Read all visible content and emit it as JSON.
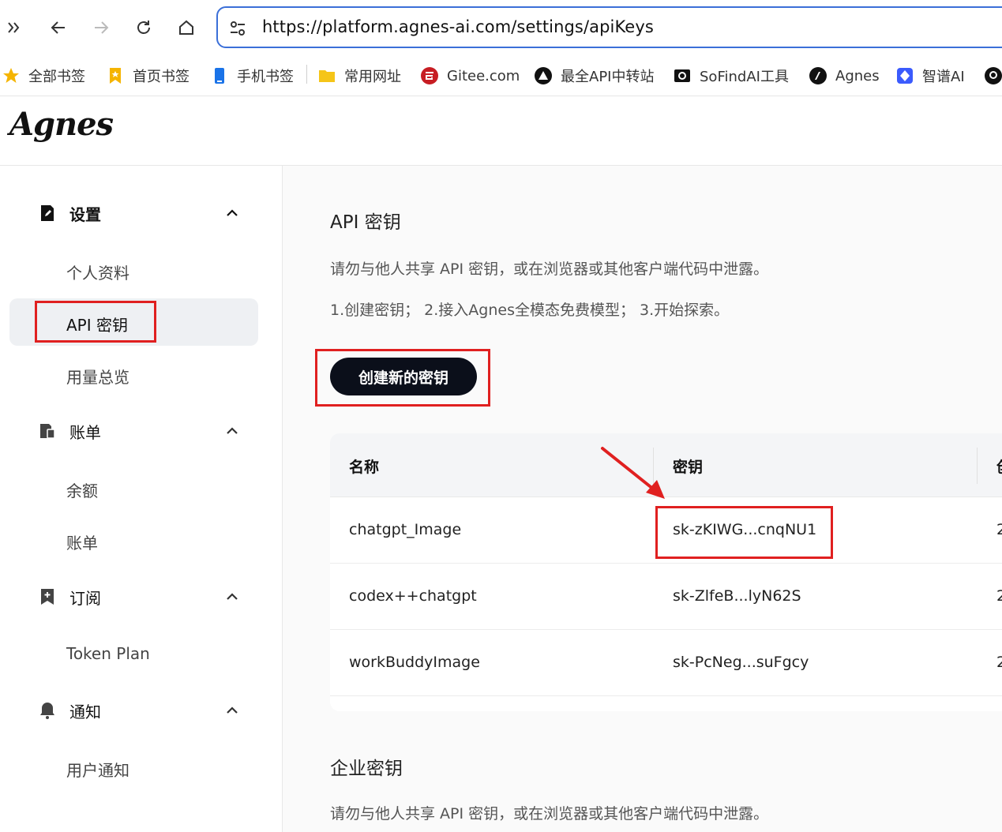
{
  "browser": {
    "url": "https://platform.agnes-ai.com/settings/apiKeys",
    "bookmarks": [
      {
        "label": "全部书签",
        "icon": "star-icon"
      },
      {
        "label": "首页书签",
        "icon": "bookmark-icon"
      },
      {
        "label": "手机书签",
        "icon": "phone-bookmark-icon"
      },
      {
        "label": "常用网址",
        "icon": "folder-icon"
      },
      {
        "label": "Gitee.com",
        "icon": "gitee-icon"
      },
      {
        "label": "最全API中转站",
        "icon": "triangle-logo-icon"
      },
      {
        "label": "SoFindAI工具",
        "icon": "sofind-icon"
      },
      {
        "label": "Agnes",
        "icon": "agnes-icon"
      },
      {
        "label": "智谱AI",
        "icon": "zhipu-icon"
      }
    ]
  },
  "app": {
    "logo": "Agnes"
  },
  "sidebar": {
    "sections": [
      {
        "label": "设置",
        "icon": "edit-doc-icon",
        "items": [
          "个人资料",
          "API 密钥",
          "用量总览"
        ]
      },
      {
        "label": "账单",
        "icon": "bill-icon",
        "items": [
          "余额",
          "账单"
        ]
      },
      {
        "label": "订阅",
        "icon": "bookmark-plus-icon",
        "items": [
          "Token Plan"
        ]
      },
      {
        "label": "通知",
        "icon": "bell-icon",
        "items": [
          "用户通知"
        ]
      }
    ],
    "active_item": "API 密钥"
  },
  "main": {
    "title": "API 密钥",
    "warning": "请勿与他人共享 API 密钥，或在浏览器或其他客户端代码中泄露。",
    "steps": "1.创建密钥； 2.接入Agnes全模态免费模型； 3.开始探索。",
    "create_button": "创建新的密钥",
    "table": {
      "headers": [
        "名称",
        "密钥",
        "创"
      ],
      "rows": [
        {
          "name": "chatgpt_Image",
          "key": "sk-zKIWG...cnqNU1",
          "extra": "2"
        },
        {
          "name": "codex++chatgpt",
          "key": "sk-ZlfeB...lyN62S",
          "extra": "2"
        },
        {
          "name": "workBuddyImage",
          "key": "sk-PcNeg...suFgcy",
          "extra": "2"
        }
      ]
    },
    "enterprise_title": "企业密钥",
    "enterprise_warning": "请勿与他人共享 API 密钥，或在浏览器或其他客户端代码中泄露。"
  },
  "colors": {
    "accent_blue": "#3b6fd8",
    "annotation_red": "#e02020",
    "button_dark": "#0b0f1a"
  }
}
